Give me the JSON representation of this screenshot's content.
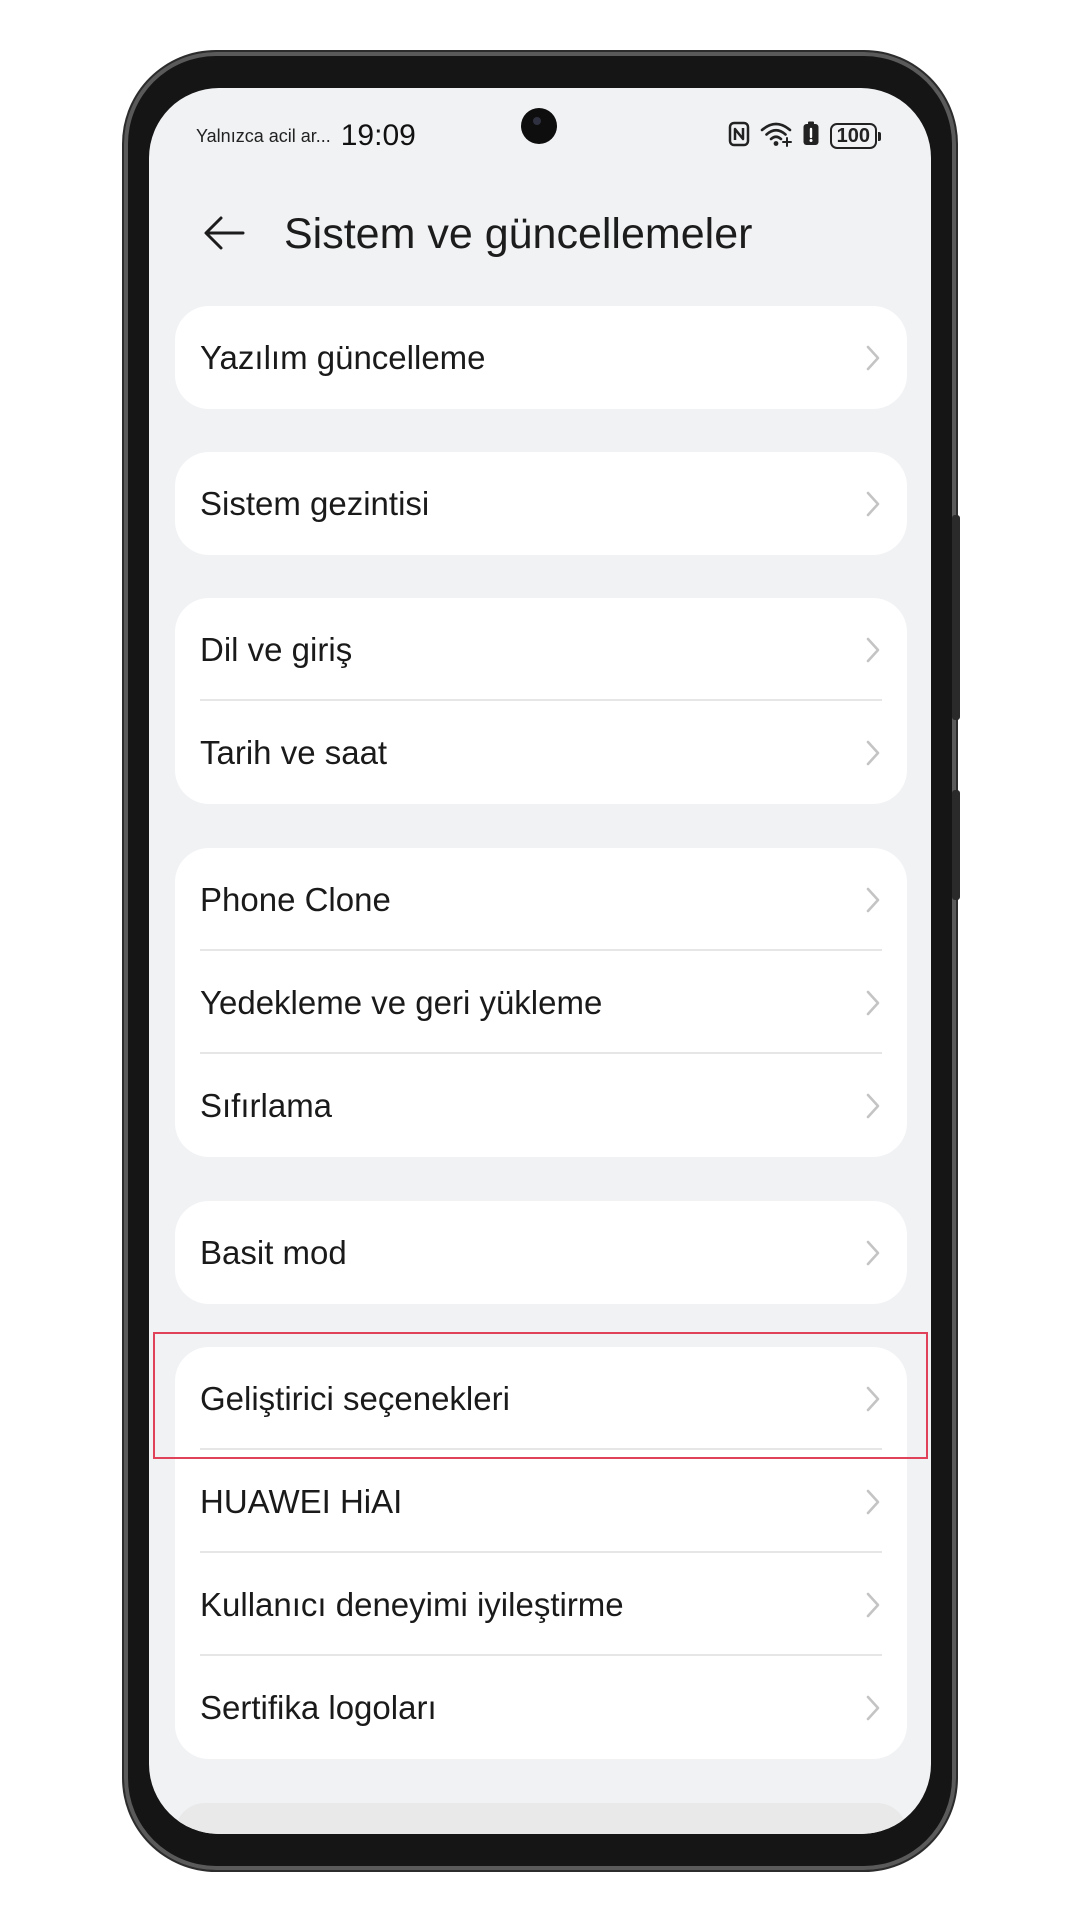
{
  "status_bar": {
    "carrier": "Yalnızca acil ar...",
    "time": "19:09",
    "battery": "100",
    "icons": [
      "nfc-icon",
      "wifi-icon",
      "battery-saver-icon",
      "battery-icon"
    ]
  },
  "header": {
    "back_icon": "arrow-left-icon",
    "title": "Sistem ve güncellemeler"
  },
  "groups": [
    {
      "items": [
        {
          "label": "Yazılım güncelleme"
        }
      ]
    },
    {
      "items": [
        {
          "label": "Sistem gezintisi"
        }
      ]
    },
    {
      "items": [
        {
          "label": "Dil ve giriş"
        },
        {
          "label": "Tarih ve saat"
        }
      ]
    },
    {
      "items": [
        {
          "label": "Phone Clone"
        },
        {
          "label": "Yedekleme ve geri yükleme"
        },
        {
          "label": "Sıfırlama"
        }
      ]
    },
    {
      "items": [
        {
          "label": "Basit mod"
        }
      ]
    },
    {
      "items": [
        {
          "label": "Geliştirici seçenekleri"
        },
        {
          "label": "HUAWEI HiAI"
        },
        {
          "label": "Kullanıcı deneyimi iyileştirme"
        },
        {
          "label": "Sertifika logoları"
        }
      ]
    }
  ],
  "highlight": {
    "target": "Geliştirici seçenekleri",
    "color": "#e0425a"
  },
  "colors": {
    "screen_background": "#f1f2f4",
    "card_background": "#ffffff",
    "text": "#1a1a1a",
    "chevron": "#c4c4c4"
  }
}
